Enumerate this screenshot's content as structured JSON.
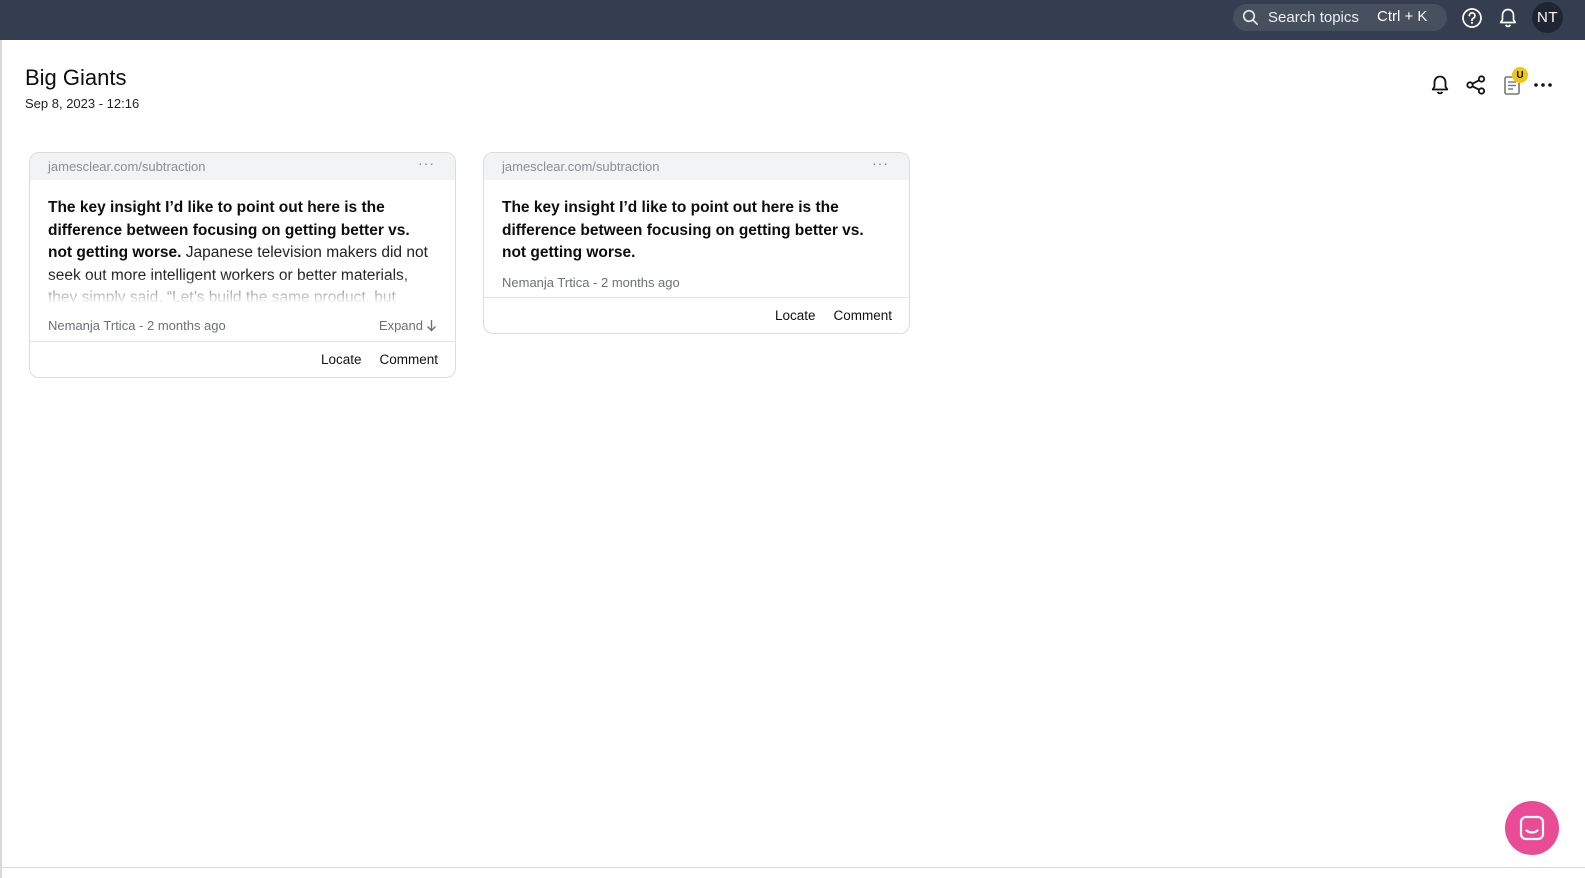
{
  "topbar": {
    "search_placeholder": "Search topics",
    "search_shortcut": "Ctrl + K",
    "avatar_initials": "NT"
  },
  "page": {
    "title": "Big Giants",
    "date": "Sep 8, 2023 - 12:16",
    "badge": "U"
  },
  "cards": [
    {
      "source": "jamesclear.com/subtraction",
      "menu": "···",
      "bold_text": "The key insight I’d like to point out here is the difference between focusing on getting better vs. not getting worse.",
      "text": " Japanese television makers did not seek out more intelligent workers or better materials, they simply said, “Let’s build the same product, but make fewer mistakes.” Japanese companies improved by",
      "meta": "Nemanja Trtica - 2 months ago",
      "expand": "Expand",
      "locate": "Locate",
      "comment": "Comment"
    },
    {
      "source": "jamesclear.com/subtraction",
      "menu": "···",
      "bold_text": "The key insight I’d like to point out here is the difference between focusing on getting better vs. not getting worse.",
      "meta": "Nemanja Trtica - 2 months ago",
      "locate": "Locate",
      "comment": "Comment"
    }
  ],
  "icons": {
    "search": "search-icon",
    "help": "help-icon",
    "notifications": "bell-icon",
    "share": "share-icon",
    "notes": "notes-icon",
    "more": "more-icon",
    "chat": "chat-icon"
  },
  "colors": {
    "topbar": "#343e4f",
    "chat_accent": "#e94b95",
    "badge": "#f0c419"
  }
}
